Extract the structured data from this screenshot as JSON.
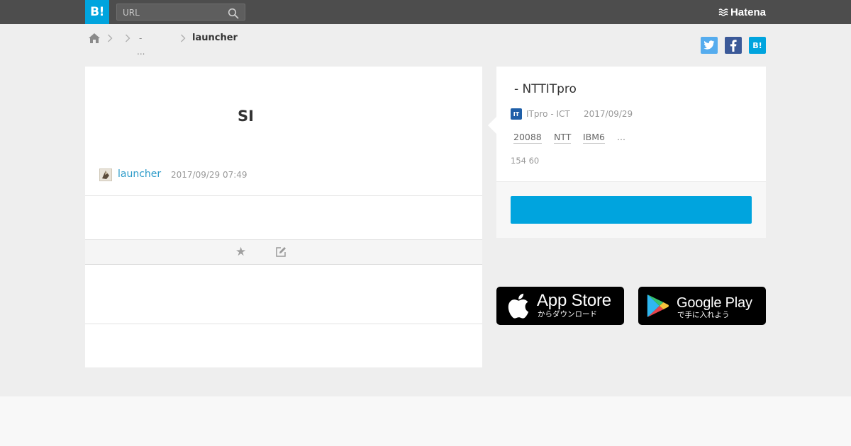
{
  "header": {
    "logo_text": "B!",
    "search_placeholder": "URL",
    "brand_name": "Hatena"
  },
  "breadcrumb": {
    "middle_text": "-",
    "middle_ellipsis": "...",
    "current": "launcher"
  },
  "share": {
    "hatena_label": "B!"
  },
  "main": {
    "title": "SI",
    "user_name": "launcher",
    "date": "2017/09/29 07:49"
  },
  "entry": {
    "title": "- NTTITpro",
    "favicon_text": "IT",
    "site": "ITpro - ICT",
    "date": "2017/09/29",
    "tags": [
      "20088",
      "NTT",
      "IBM6"
    ],
    "tags_more": "...",
    "counts": "154 60"
  },
  "badges": {
    "app_store_main": "App Store",
    "app_store_sub": "からダウンロード",
    "google_play_main": "Google Play",
    "google_play_sub": "で手に入れよう"
  },
  "colors": {
    "header_bg": "#4d4d4d",
    "accent": "#00a4de",
    "user_link": "#2c9bc9",
    "twitter": "#55acee",
    "facebook": "#3b5998"
  }
}
